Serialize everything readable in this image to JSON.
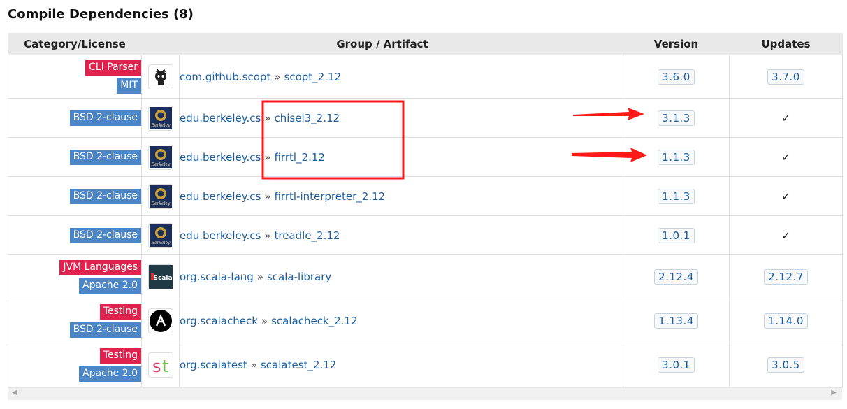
{
  "section": {
    "title": "Compile Dependencies (8)"
  },
  "table": {
    "headers": [
      "Category/License",
      "Group / Artifact",
      "Version",
      "Updates"
    ],
    "rows": [
      {
        "category": "CLI Parser",
        "license": "MIT",
        "logo": "github-octocat-icon",
        "group": "com.github.scopt",
        "artifact": "scopt_2.12",
        "version": "3.6.0",
        "update": "3.7.0"
      },
      {
        "category": "",
        "license": "BSD 2-clause",
        "logo": "berkeley-seal-icon",
        "group": "edu.berkeley.cs",
        "artifact": "chisel3_2.12",
        "version": "3.1.3",
        "update": "✓"
      },
      {
        "category": "",
        "license": "BSD 2-clause",
        "logo": "berkeley-seal-icon",
        "group": "edu.berkeley.cs",
        "artifact": "firrtl_2.12",
        "version": "1.1.3",
        "update": "✓"
      },
      {
        "category": "",
        "license": "BSD 2-clause",
        "logo": "berkeley-seal-icon",
        "group": "edu.berkeley.cs",
        "artifact": "firrtl-interpreter_2.12",
        "version": "1.1.3",
        "update": "✓"
      },
      {
        "category": "",
        "license": "BSD 2-clause",
        "logo": "berkeley-seal-icon",
        "group": "edu.berkeley.cs",
        "artifact": "treadle_2.12",
        "version": "1.0.1",
        "update": "✓"
      },
      {
        "category": "JVM Languages",
        "license": "Apache 2.0",
        "logo": "scala-logo-icon",
        "group": "org.scala-lang",
        "artifact": "scala-library",
        "version": "2.12.4",
        "update": "2.12.7"
      },
      {
        "category": "Testing",
        "license": "BSD 2-clause",
        "logo": "scalacheck-logo-icon",
        "group": "org.scalacheck",
        "artifact": "scalacheck_2.12",
        "version": "1.13.4",
        "update": "1.14.0"
      },
      {
        "category": "Testing",
        "license": "Apache 2.0",
        "logo": "scalatest-logo-icon",
        "group": "org.scalatest",
        "artifact": "scalatest_2.12",
        "version": "3.0.1",
        "update": "3.0.5"
      }
    ],
    "separator": "»"
  },
  "logo_text": {
    "scala": "Scala",
    "berkeley": "Berkeley"
  },
  "colors": {
    "category_badge": "#e0234e",
    "license_badge": "#4c86c6",
    "link": "#1d5ea0",
    "annotation": "#ff1a1a"
  },
  "scrollbar": {
    "left_arrow": "◀",
    "right_arrow": "▶"
  }
}
